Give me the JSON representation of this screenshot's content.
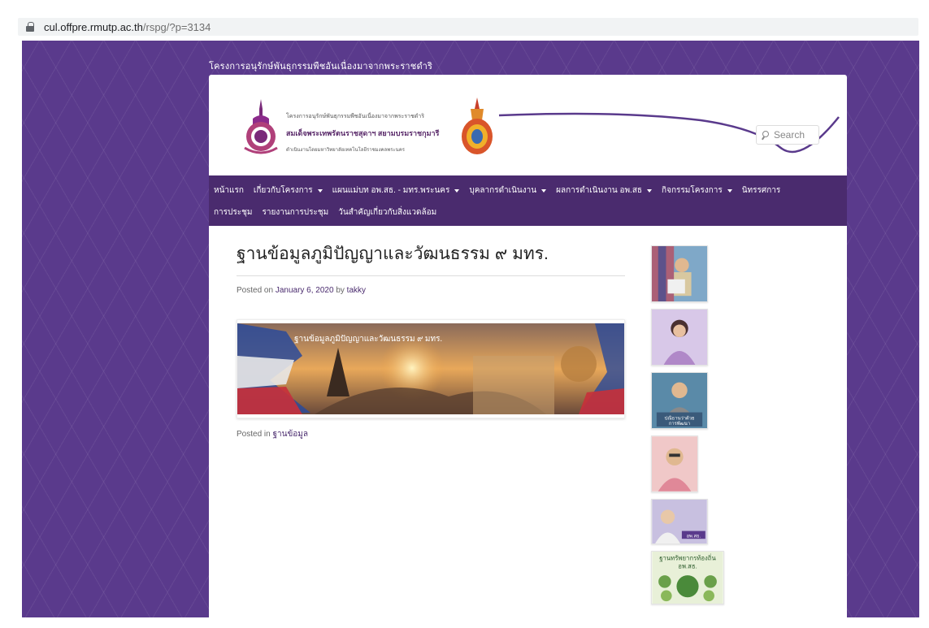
{
  "browser": {
    "url_host": "cul.offpre.rmutp.ac.th",
    "url_path": "/rspg/?p=3134"
  },
  "site": {
    "top_title": "โครงการอนุรักษ์พันธุกรรมพืชอันเนื่องมาจากพระราชดำริ",
    "header_line1": "โครงการอนุรักษ์พันธุกรรมพืชอันเนื่องมาจากพระราชดำริ",
    "header_line2": "สมเด็จพระเทพรัตนราชสุดาฯ สยามบรมราชกุมารี",
    "header_line3": "ดำเนินงานโดยมหาวิทยาลัยเทคโนโลยีราชมงคลพระนคร"
  },
  "search": {
    "placeholder": "Search"
  },
  "nav": {
    "row1": [
      {
        "label": "หน้าแรก",
        "dropdown": false
      },
      {
        "label": "เกี่ยวกับโครงการ",
        "dropdown": true
      },
      {
        "label": "แผนแม่บท อพ.สธ. - มทร.พระนคร",
        "dropdown": true
      },
      {
        "label": "บุคลากรดำเนินงาน",
        "dropdown": true
      },
      {
        "label": "ผลการดำเนินงาน อพ.สธ",
        "dropdown": true
      },
      {
        "label": "กิจกรรมโครงการ",
        "dropdown": true
      },
      {
        "label": "นิทรรศการ",
        "dropdown": false
      }
    ],
    "row2": [
      {
        "label": "การประชุม",
        "dropdown": false
      },
      {
        "label": "รายงานการประชุม",
        "dropdown": false
      },
      {
        "label": "วันสำคัญเกี่ยวกับสิ่งแวดล้อม",
        "dropdown": false
      }
    ]
  },
  "post": {
    "title": "ฐานข้อมูลภูมิปัญญาและวัฒนธรรม ๙ มทร.",
    "posted_on_label": "Posted on",
    "date": "January 6, 2020",
    "by_label": "by",
    "author": "takky",
    "banner_caption": "ฐานข้อมูลภูมิปัญญาและวัฒนธรรม ๙ มทร.",
    "posted_in_label": "Posted in",
    "category": "ฐานข้อมูล"
  },
  "sidebar": {
    "thumbs": [
      {
        "icon": "king-portrait-thumb"
      },
      {
        "icon": "queen-portrait-thumb"
      },
      {
        "icon": "king-seaside-thumb",
        "caption": "ปณิธานว่าด้วย การพัฒนา"
      },
      {
        "icon": "king-portrait-pink-thumb"
      },
      {
        "icon": "princess-thumb",
        "caption": "อพ.สธ."
      },
      {
        "icon": "local-resources-thumb",
        "caption": "ฐานทรัพยากรท้องถิ่น อพ.สธ."
      }
    ]
  },
  "colors": {
    "purple_bg": "#5a3a8c",
    "nav_bg": "#4a2b6e",
    "link": "#4a2b6e"
  }
}
